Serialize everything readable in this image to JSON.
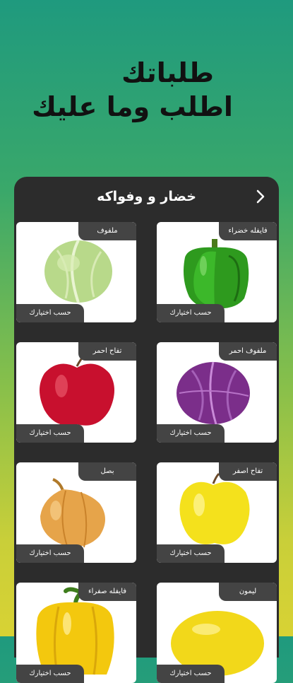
{
  "headline": {
    "line1": "طلباتك",
    "line2": "اطلب وما عليك"
  },
  "screen": {
    "title": "خضار و وفواكه"
  },
  "products": [
    {
      "name": "فايفله خضراء",
      "pick": "حسب اختيارك",
      "icon": "green-pepper-image"
    },
    {
      "name": "ملفوف",
      "pick": "حسب اختيارك",
      "icon": "cabbage-image"
    },
    {
      "name": "ملفوف احمر",
      "pick": "حسب اختيارك",
      "icon": "red-cabbage-image"
    },
    {
      "name": "تفاح احمر",
      "pick": "حسب اختيارك",
      "icon": "red-apple-image"
    },
    {
      "name": "تفاح اصفر",
      "pick": "حسب اختيارك",
      "icon": "yellow-apple-image"
    },
    {
      "name": "بصل",
      "pick": "حسب اختيارك",
      "icon": "onion-image"
    },
    {
      "name": "ليمون",
      "pick": "حسب اختيارك",
      "icon": "lemon-image"
    },
    {
      "name": "فايفله صفراء",
      "pick": "حسب اختيارك",
      "icon": "yellow-pepper-image"
    }
  ]
}
